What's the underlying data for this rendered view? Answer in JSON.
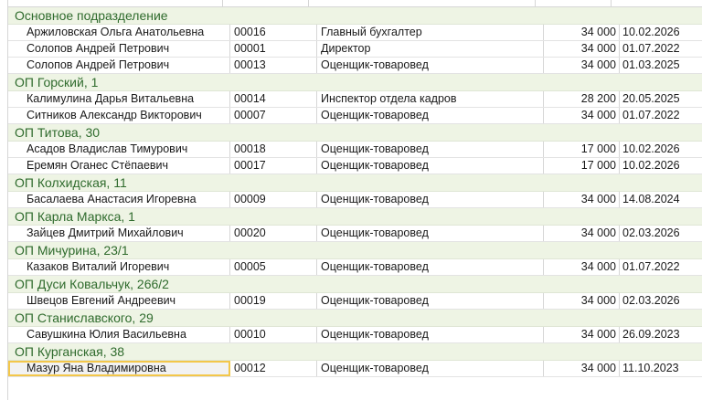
{
  "groups": [
    {
      "title": "Основное подразделение",
      "rows": [
        {
          "name": "Аржиловская Ольга Анатольевна",
          "number": "00016",
          "position": "Главный бухгалтер",
          "salary": "34 000",
          "date": "10.02.2026"
        },
        {
          "name": "Солопов Андрей Петрович",
          "number": "00001",
          "position": "Директор",
          "salary": "34 000",
          "date": "01.07.2022"
        },
        {
          "name": "Солопов Андрей Петрович",
          "number": "00013",
          "position": "Оценщик-товаровед",
          "salary": "34 000",
          "date": "01.03.2025"
        }
      ]
    },
    {
      "title": "ОП Горский, 1",
      "rows": [
        {
          "name": "Калимулина Дарья Витальевна",
          "number": "00014",
          "position": "Инспектор отдела кадров",
          "salary": "28 200",
          "date": "20.05.2025"
        },
        {
          "name": "Ситников Александр Викторович",
          "number": "00007",
          "position": "Оценщик-товаровед",
          "salary": "34 000",
          "date": "01.07.2022"
        }
      ]
    },
    {
      "title": "ОП Титова, 30",
      "rows": [
        {
          "name": "Асадов Владислав Тимурович",
          "number": "00018",
          "position": "Оценщик-товаровед",
          "salary": "17 000",
          "date": "10.02.2026"
        },
        {
          "name": "Еремян Оганес Стёпаевич",
          "number": "00017",
          "position": "Оценщик-товаровед",
          "salary": "17 000",
          "date": "10.02.2026"
        }
      ]
    },
    {
      "title": "ОП Колхидская, 11",
      "rows": [
        {
          "name": "Басалаева Анастасия Игоревна",
          "number": "00009",
          "position": "Оценщик-товаровед",
          "salary": "34 000",
          "date": "14.08.2024"
        }
      ]
    },
    {
      "title": "ОП Карла Маркса, 1",
      "rows": [
        {
          "name": "Зайцев Дмитрий Михайлович",
          "number": "00020",
          "position": "Оценщик-товаровед",
          "salary": "34 000",
          "date": "02.03.2026"
        }
      ]
    },
    {
      "title": "ОП Мичурина, 23/1",
      "rows": [
        {
          "name": "Казаков Виталий Игоревич",
          "number": "00005",
          "position": "Оценщик-товаровед",
          "salary": "34 000",
          "date": "01.07.2022"
        }
      ]
    },
    {
      "title": "ОП Дуси Ковальчук, 266/2",
      "rows": [
        {
          "name": "Швецов Евгений Андреевич",
          "number": "00019",
          "position": "Оценщик-товаровед",
          "salary": "34 000",
          "date": "02.03.2026"
        }
      ]
    },
    {
      "title": "ОП Станиславского, 29",
      "rows": [
        {
          "name": "Савушкина Юлия Васильевна",
          "number": "00010",
          "position": "Оценщик-товаровед",
          "salary": "34 000",
          "date": "26.09.2023"
        }
      ]
    },
    {
      "title": "ОП Курганская, 38",
      "rows": [
        {
          "name": "Мазур Яна Владимировна",
          "number": "00012",
          "position": "Оценщик-товаровед",
          "salary": "34 000",
          "date": "11.10.2023",
          "selected": true
        }
      ]
    }
  ],
  "colors": {
    "group_bg": "#eef4e4",
    "group_text": "#2f6b2d",
    "selection_border": "#f3c74a"
  }
}
